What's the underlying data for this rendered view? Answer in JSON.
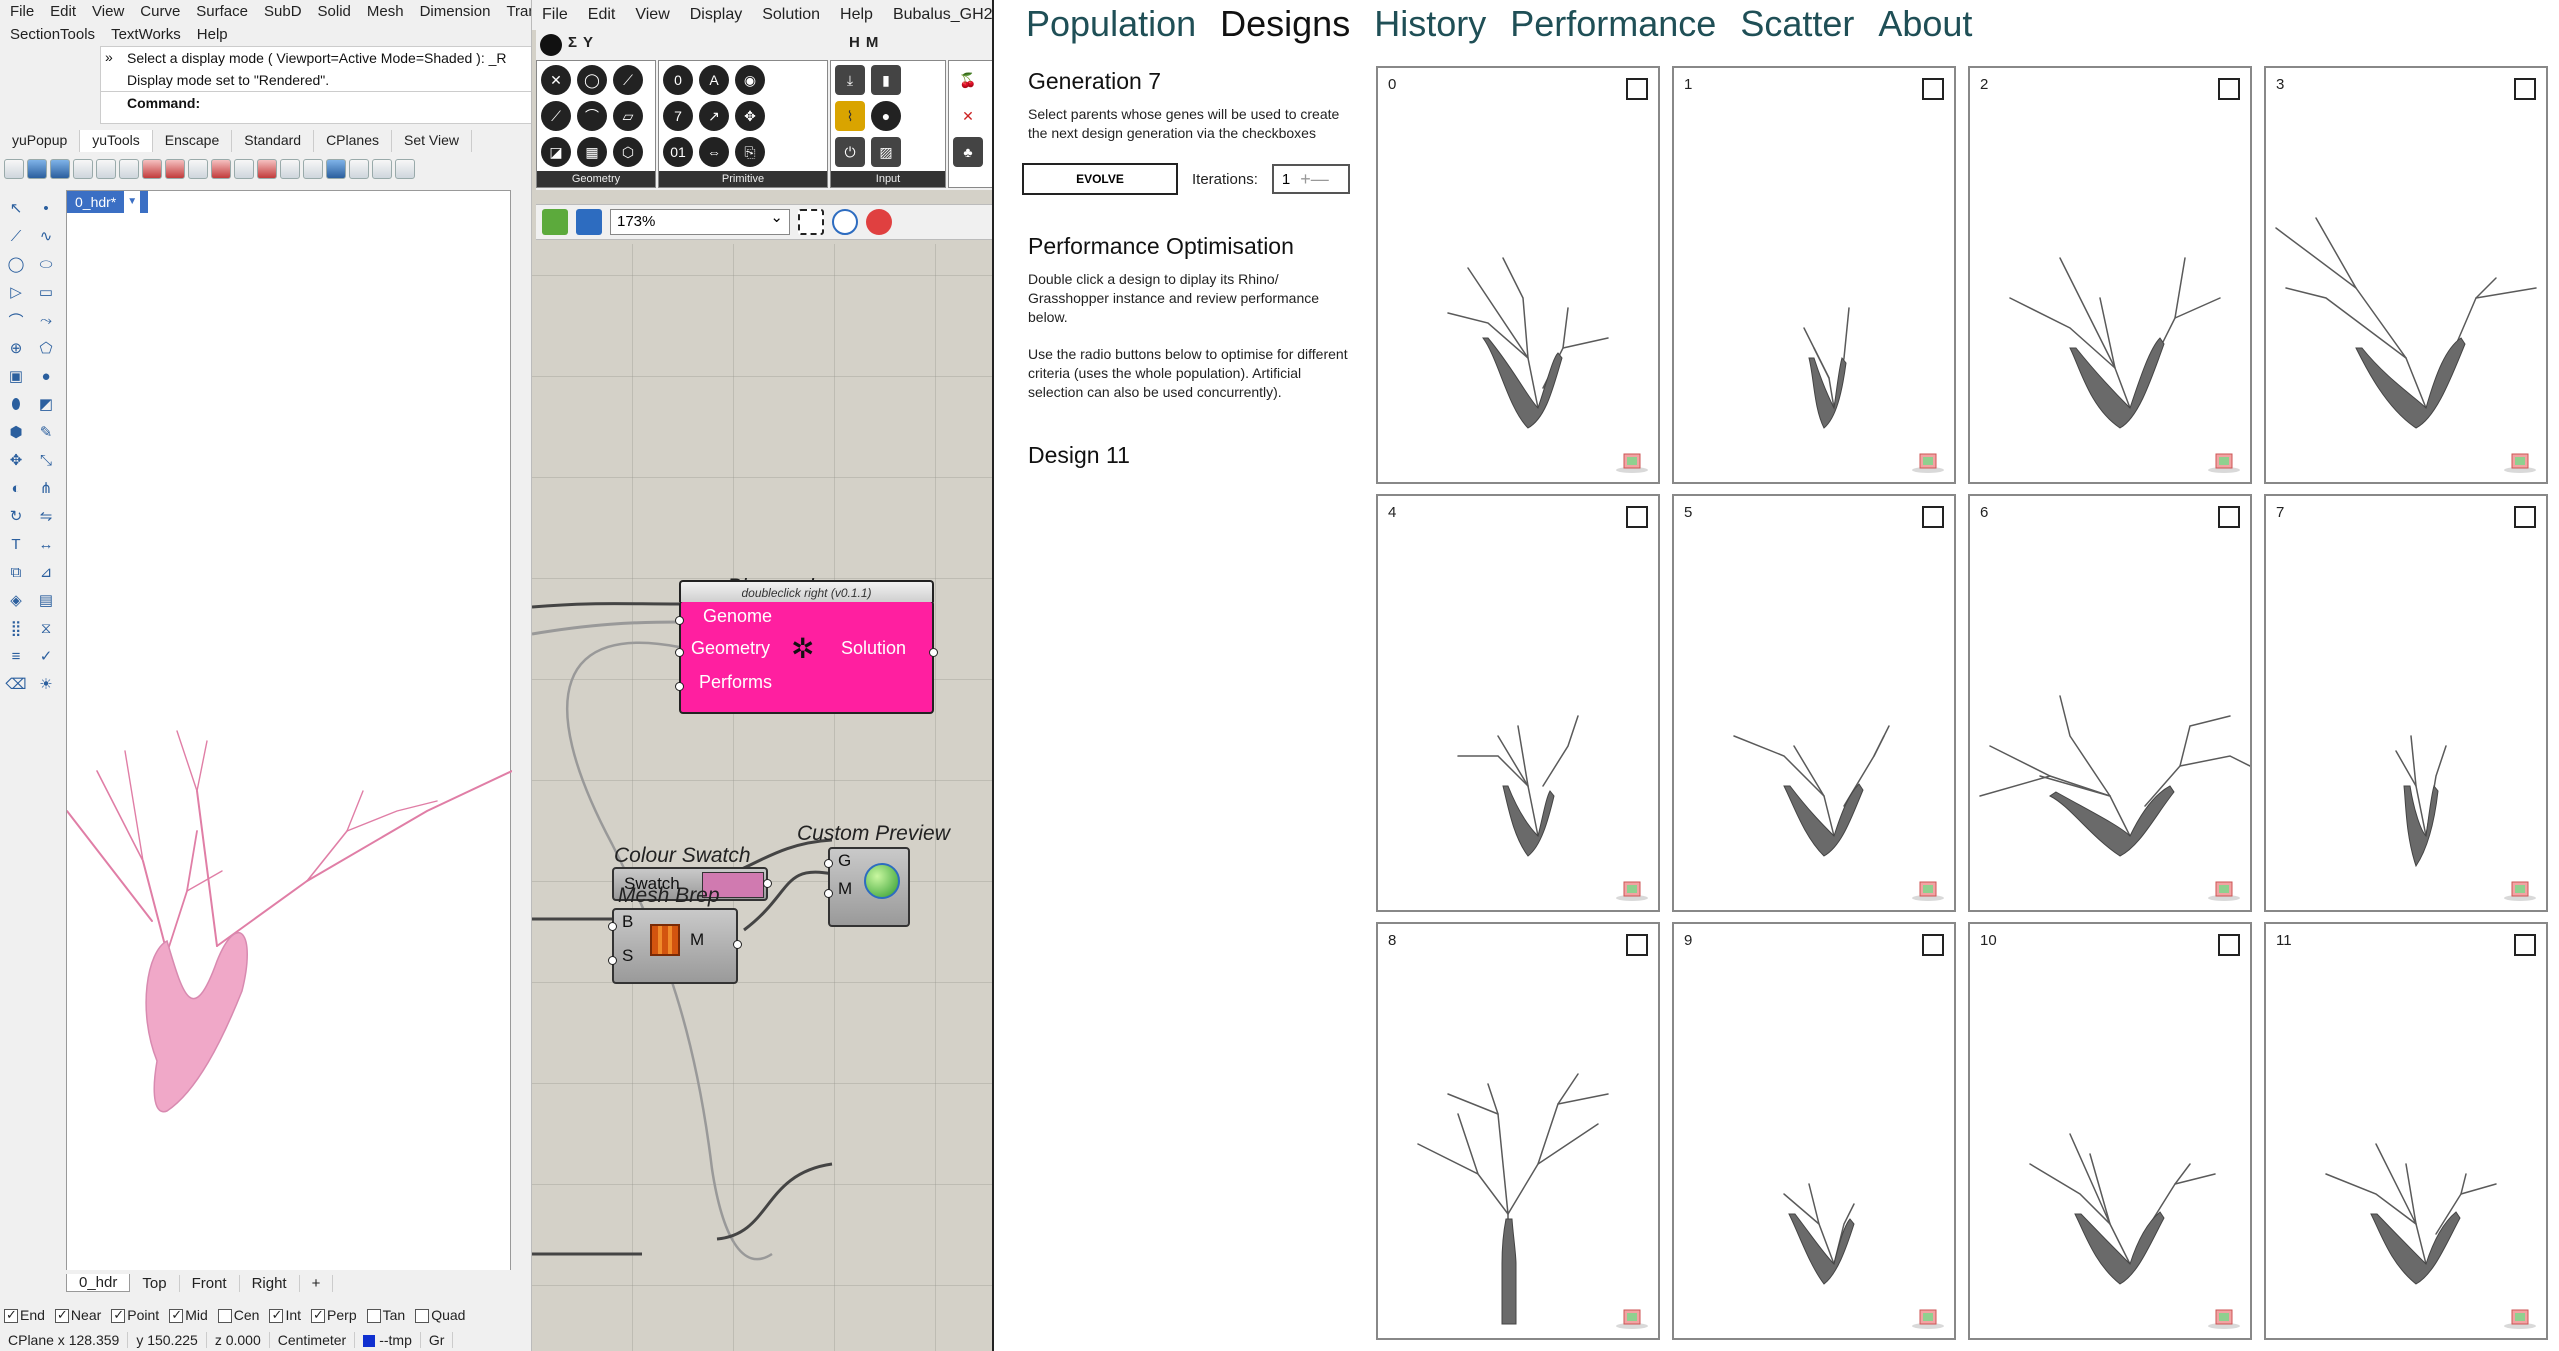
{
  "rhino": {
    "menu1": [
      "File",
      "Edit",
      "View",
      "Curve",
      "Surface",
      "SubD",
      "Solid",
      "Mesh",
      "Dimension",
      "Tran"
    ],
    "menu2": [
      "SectionTools",
      "TextWorks",
      "Help"
    ],
    "cmd_lines": [
      "Select a display mode ( Viewport=Active  Mode=Shaded ): _R",
      "Display mode set to \"Rendered\"."
    ],
    "cmd_prompt": "Command:",
    "tabs": [
      "yuPopup",
      "yuTools",
      "Enscape",
      "Standard",
      "CPlanes",
      "Set View"
    ],
    "active_tab": "yuTools",
    "viewport_name": "0_hdr*",
    "viewport_tabs": [
      "0_hdr",
      "Top",
      "Front",
      "Right",
      "+"
    ],
    "osnaps": [
      {
        "label": "End",
        "checked": true
      },
      {
        "label": "Near",
        "checked": true
      },
      {
        "label": "Point",
        "checked": true
      },
      {
        "label": "Mid",
        "checked": true
      },
      {
        "label": "Cen",
        "checked": false
      },
      {
        "label": "Int",
        "checked": true
      },
      {
        "label": "Perp",
        "checked": true
      },
      {
        "label": "Tan",
        "checked": false
      },
      {
        "label": "Quad",
        "checked": false
      }
    ],
    "status": {
      "cplane": "CPlane x 128.359",
      "y": "y 150.225",
      "z": "z 0.000",
      "units": "Centimeter",
      "layer": "--tmp",
      "extra": "Gr"
    },
    "tree_color": "#e07ea6"
  },
  "gh": {
    "menu": [
      "File",
      "Edit",
      "View",
      "Display",
      "Solution",
      "Help",
      "Bubalus_GH2"
    ],
    "tabs": [
      "Σ",
      "Y",
      "H",
      "M"
    ],
    "groups": [
      "Geometry",
      "Primitive",
      "Input"
    ],
    "zoom": "173%",
    "biomorpher": {
      "title": "Biomorpher",
      "subtitle": "doubleclick right (v0.1.1)",
      "inputs": [
        "Genome",
        "Geometry",
        "Performs"
      ],
      "output": "Solution",
      "color": "#ff1fa0"
    },
    "custom_preview": {
      "title": "Custom Preview",
      "inputs": [
        "G",
        "M"
      ]
    },
    "colour_swatch": {
      "title": "Colour Swatch",
      "label": "Swatch",
      "swatch": "#d07ab0"
    },
    "mesh_brep": {
      "title": "Mesh Brep",
      "inputs": [
        "B",
        "S"
      ],
      "output": "M"
    }
  },
  "app": {
    "nav": [
      "Population",
      "Designs",
      "History",
      "Performance",
      "Scatter",
      "About"
    ],
    "active_nav": "Designs",
    "generation_title": "Generation 7",
    "generation_text": "Select parents whose genes will be used to create the next design generation via the checkboxes",
    "evolve_label": "EVOLVE",
    "iterations_label": "Iterations:",
    "iterations_value": "1",
    "perf_title": "Performance Optimisation",
    "perf_text1": "Double click a design to diplay its Rhino/ Grasshopper instance and review performance below.",
    "perf_text2": "Use the radio buttons below to optimise for different criteria (uses the whole population). Artificial selection can also be used concurrently).",
    "design_title": "Design 11",
    "designs": [
      {
        "id": "0",
        "checked": false
      },
      {
        "id": "1",
        "checked": false
      },
      {
        "id": "2",
        "checked": false
      },
      {
        "id": "3",
        "checked": false
      },
      {
        "id": "4",
        "checked": false
      },
      {
        "id": "5",
        "checked": false
      },
      {
        "id": "6",
        "checked": false
      },
      {
        "id": "7",
        "checked": false
      },
      {
        "id": "8",
        "checked": false
      },
      {
        "id": "9",
        "checked": false
      },
      {
        "id": "10",
        "checked": false
      },
      {
        "id": "11",
        "checked": false
      }
    ],
    "tree_color": "#5a5a5a"
  }
}
